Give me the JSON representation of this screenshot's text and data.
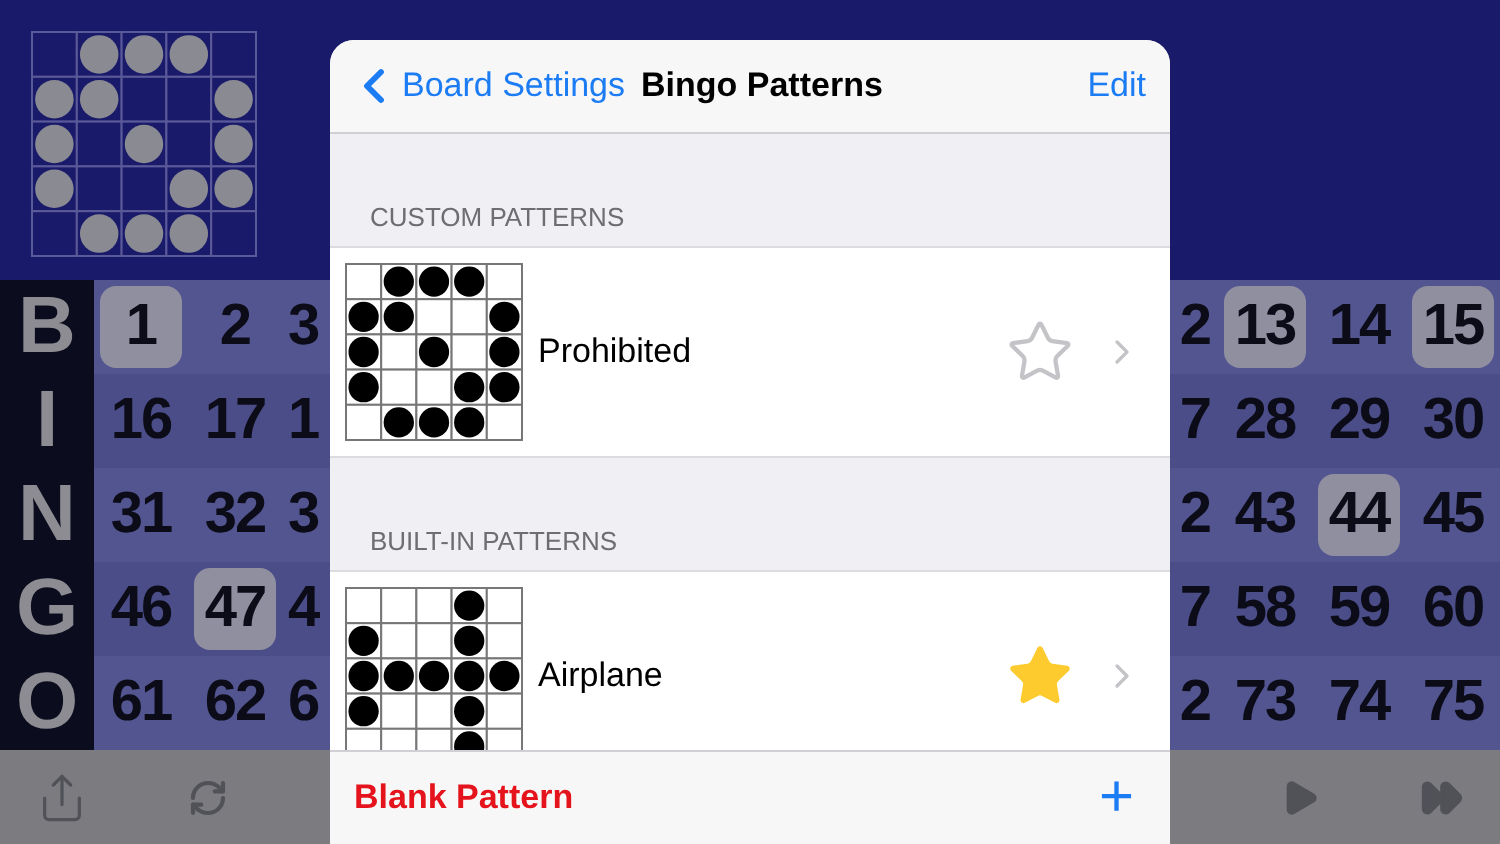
{
  "current_pattern": {
    "rows": [
      [
        false,
        true,
        true,
        true,
        false
      ],
      [
        true,
        true,
        false,
        false,
        true
      ],
      [
        true,
        false,
        true,
        false,
        true
      ],
      [
        true,
        false,
        false,
        true,
        true
      ],
      [
        false,
        true,
        true,
        true,
        false
      ]
    ]
  },
  "board": [
    {
      "letter": "B",
      "left": [
        {
          "text": "1",
          "marked": true
        },
        {
          "text": "2",
          "marked": false
        },
        {
          "text": "3",
          "marked": false
        }
      ],
      "right": [
        {
          "text": "2",
          "marked": false
        },
        {
          "text": "13",
          "marked": true
        },
        {
          "text": "14",
          "marked": false
        },
        {
          "text": "15",
          "marked": true
        }
      ]
    },
    {
      "letter": "I",
      "left": [
        {
          "text": "16",
          "marked": false
        },
        {
          "text": "17",
          "marked": false
        },
        {
          "text": "1",
          "marked": false
        }
      ],
      "right": [
        {
          "text": "7",
          "marked": false
        },
        {
          "text": "28",
          "marked": false
        },
        {
          "text": "29",
          "marked": false
        },
        {
          "text": "30",
          "marked": false
        }
      ]
    },
    {
      "letter": "N",
      "left": [
        {
          "text": "31",
          "marked": false
        },
        {
          "text": "32",
          "marked": false
        },
        {
          "text": "3",
          "marked": false
        }
      ],
      "right": [
        {
          "text": "2",
          "marked": false
        },
        {
          "text": "43",
          "marked": false
        },
        {
          "text": "44",
          "marked": true
        },
        {
          "text": "45",
          "marked": false
        }
      ]
    },
    {
      "letter": "G",
      "left": [
        {
          "text": "46",
          "marked": false
        },
        {
          "text": "47",
          "marked": true
        },
        {
          "text": "4",
          "marked": false
        }
      ],
      "right": [
        {
          "text": "7",
          "marked": false
        },
        {
          "text": "58",
          "marked": false
        },
        {
          "text": "59",
          "marked": false
        },
        {
          "text": "60",
          "marked": false
        }
      ]
    },
    {
      "letter": "O",
      "left": [
        {
          "text": "61",
          "marked": false
        },
        {
          "text": "62",
          "marked": false
        },
        {
          "text": "6",
          "marked": false
        }
      ],
      "right": [
        {
          "text": "2",
          "marked": false
        },
        {
          "text": "73",
          "marked": false
        },
        {
          "text": "74",
          "marked": false
        },
        {
          "text": "75",
          "marked": false
        }
      ]
    }
  ],
  "modal": {
    "back": "Board Settings",
    "title": "Bingo Patterns",
    "action": "Edit",
    "sections": [
      {
        "header": "CUSTOM PATTERNS",
        "items": [
          {
            "name": "Prohibited",
            "favorite": false,
            "rows": [
              [
                false,
                true,
                true,
                true,
                false
              ],
              [
                true,
                true,
                false,
                false,
                true
              ],
              [
                true,
                false,
                true,
                false,
                true
              ],
              [
                true,
                false,
                false,
                true,
                true
              ],
              [
                false,
                true,
                true,
                true,
                false
              ]
            ]
          }
        ]
      },
      {
        "header": "BUILT-IN PATTERNS",
        "items": [
          {
            "name": "Airplane",
            "favorite": true,
            "rows": [
              [
                false,
                false,
                false,
                true,
                false
              ],
              [
                true,
                false,
                false,
                true,
                false
              ],
              [
                true,
                true,
                true,
                true,
                true
              ],
              [
                true,
                false,
                false,
                true,
                false
              ],
              [
                false,
                false,
                false,
                true,
                false
              ]
            ]
          }
        ]
      }
    ],
    "toolbar": {
      "label": "Blank Pattern",
      "add": "+"
    }
  }
}
